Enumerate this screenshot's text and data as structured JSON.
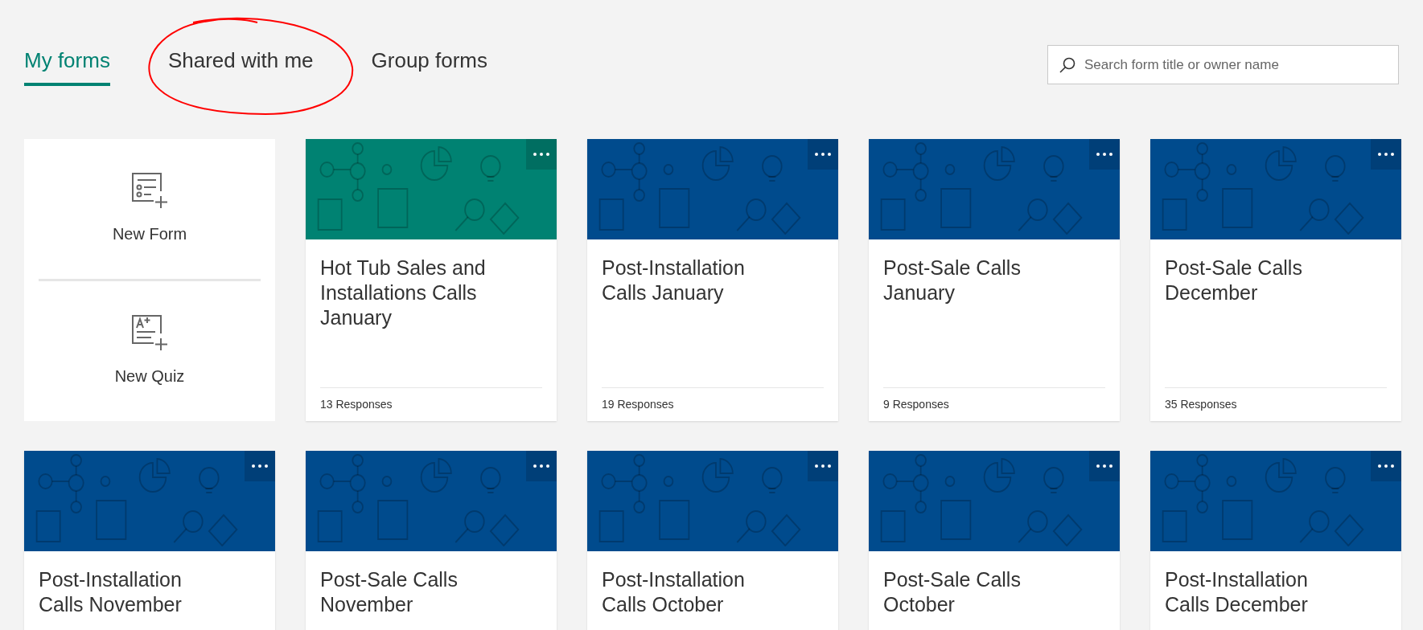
{
  "tabs": [
    {
      "label": "My forms",
      "selected": true
    },
    {
      "label": "Shared with me",
      "selected": false
    },
    {
      "label": "Group forms",
      "selected": false
    }
  ],
  "search": {
    "placeholder": "Search form title or owner name"
  },
  "new_items": [
    {
      "kind": "form",
      "label": "New Form"
    },
    {
      "kind": "quiz",
      "label": "New Quiz"
    }
  ],
  "forms": [
    {
      "title": "Hot Tub Sales and Installations Calls January",
      "responses": "13 Responses",
      "color": "#008272"
    },
    {
      "title": "Post-Installation Calls January",
      "responses": "19 Responses",
      "color": "#004b8d"
    },
    {
      "title": "Post-Sale Calls January",
      "responses": "9 Responses",
      "color": "#004b8d"
    },
    {
      "title": "Post-Sale Calls December",
      "responses": "35 Responses",
      "color": "#004b8d"
    },
    {
      "title": "Post-Installation Calls November",
      "color": "#004b8d"
    },
    {
      "title": "Post-Sale Calls November",
      "color": "#004b8d"
    },
    {
      "title": "Post-Installation Calls October",
      "color": "#004b8d"
    },
    {
      "title": "Post-Sale Calls October",
      "color": "#004b8d"
    },
    {
      "title": "Post-Installation Calls December",
      "color": "#004b8d"
    }
  ]
}
